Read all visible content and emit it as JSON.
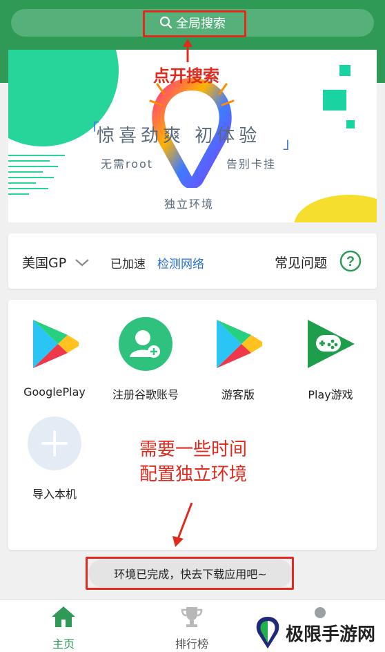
{
  "search": {
    "label": "全局搜索"
  },
  "annotations": {
    "open_search": "点开搜索",
    "need_time_line1": "需要一些时间",
    "need_time_line2": "配置独立环境"
  },
  "banner": {
    "slogan": "惊喜劲爽  初体验",
    "left_text": "无需root",
    "right_text": "告别卡挂",
    "bottom_text": "独立环境"
  },
  "region": {
    "server": "美国GP",
    "status": "已加速",
    "check_network": "检测网络",
    "faq": "常见问题"
  },
  "apps": [
    {
      "label": "GooglePlay",
      "icon": "google-play-icon"
    },
    {
      "label": "注册谷歌账号",
      "icon": "add-account-icon"
    },
    {
      "label": "游客版",
      "icon": "google-play-icon"
    },
    {
      "label": "Play游戏",
      "icon": "play-games-icon"
    },
    {
      "label": "导入本机",
      "icon": "plus-icon"
    }
  ],
  "toast": "环境已完成，快去下载应用吧~",
  "tabs": [
    {
      "label": "主页",
      "icon": "home-icon",
      "active": true
    },
    {
      "label": "排行榜",
      "icon": "trophy-icon",
      "active": false
    }
  ],
  "watermark": "极限手游网",
  "colors": {
    "brand_green": "#2e9a55",
    "link_blue": "#2a6fd1",
    "annotation_red": "#e02a1e"
  }
}
